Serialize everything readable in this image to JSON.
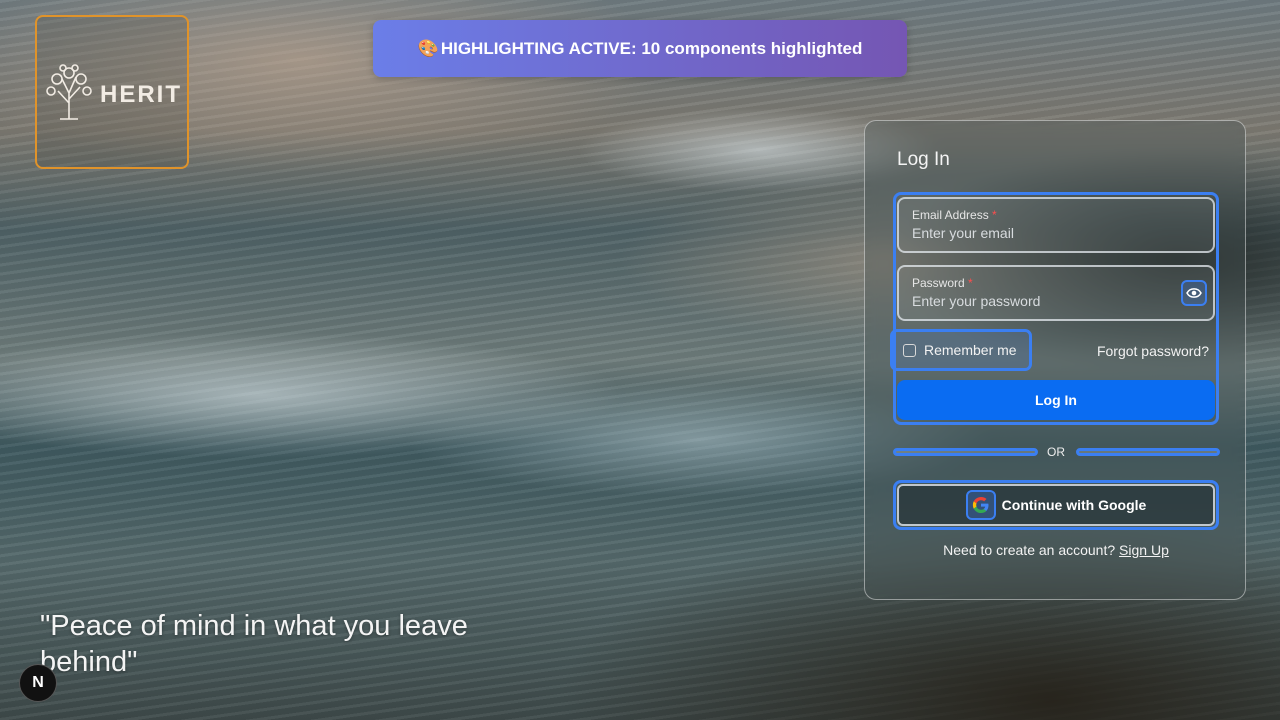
{
  "brand": {
    "logo_text": "HERIT"
  },
  "banner": {
    "emoji": "🎨",
    "text": "HIGHLIGHTING ACTIVE: 10 components highlighted"
  },
  "login": {
    "title": "Log In",
    "email_label": "Email Address",
    "email_placeholder": "Enter your email",
    "password_label": "Password",
    "password_placeholder": "Enter your password",
    "required_mark": "*",
    "remember_label": "Remember me",
    "forgot_label": "Forgot password?",
    "submit_label": "Log In",
    "divider_text": "OR",
    "google_label": "Continue with Google",
    "signup_prompt": "Need to create an account?",
    "signup_link": "Sign Up"
  },
  "quote": "\"Peace of mind in what you leave behind\"",
  "dev_badge": "N",
  "colors": {
    "highlight": "#3b7ff2",
    "primary": "#0a6cf2",
    "logo_highlight": "#e0932a"
  }
}
